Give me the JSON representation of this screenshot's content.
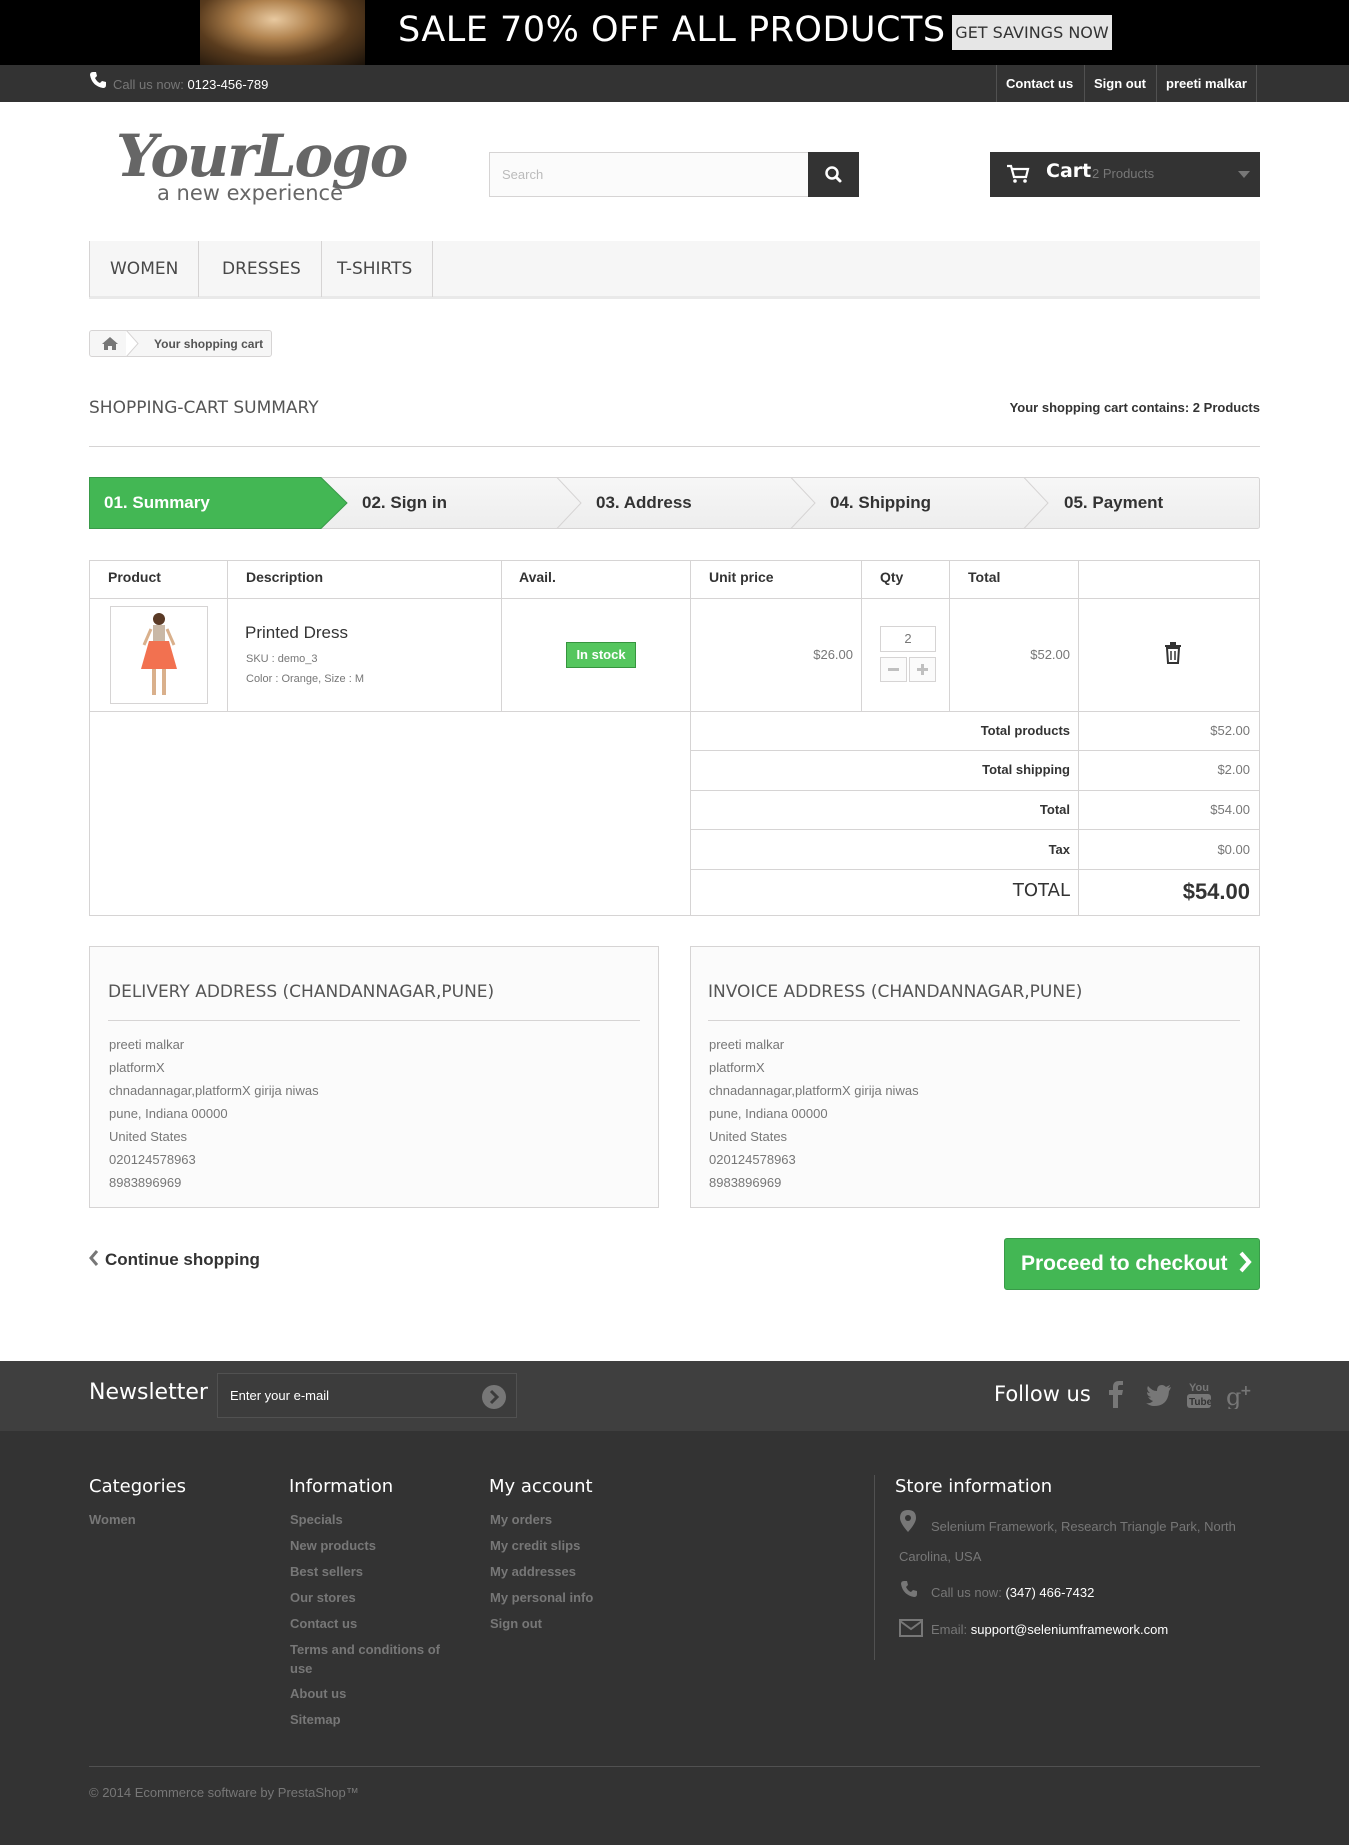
{
  "banner": {
    "text": "SALE 70% OFF ALL PRODUCTS",
    "button": "GET SAVINGS NOW"
  },
  "topbar": {
    "call_label": "Call us now:",
    "phone": "0123-456-789",
    "links": [
      "Contact us",
      "Sign out",
      "preeti malkar"
    ]
  },
  "header": {
    "logo_main": "YourLogo",
    "logo_sub": "a new experience",
    "search_placeholder": "Search",
    "cart_label": "Cart",
    "cart_count": "2 Products"
  },
  "menu": [
    "WOMEN",
    "DRESSES",
    "T-SHIRTS"
  ],
  "breadcrumb": {
    "current": "Your shopping cart"
  },
  "page": {
    "title": "SHOPPING-CART SUMMARY",
    "contains": "Your shopping cart contains: 2 Products"
  },
  "steps": [
    "01. Summary",
    "02. Sign in",
    "03. Address",
    "04. Shipping",
    "05. Payment"
  ],
  "table": {
    "headers": [
      "Product",
      "Description",
      "Avail.",
      "Unit price",
      "Qty",
      "Total"
    ],
    "item": {
      "name": "Printed Dress",
      "sku": "SKU : demo_3",
      "attrs": "Color : Orange, Size : M",
      "avail": "In stock",
      "unit_price": "$26.00",
      "qty": "2",
      "total": "$52.00"
    },
    "totals": [
      {
        "label": "Total products",
        "value": "$52.00"
      },
      {
        "label": "Total shipping",
        "value": "$2.00"
      },
      {
        "label": "Total",
        "value": "$54.00"
      },
      {
        "label": "Tax",
        "value": "$0.00"
      }
    ],
    "grand_label": "TOTAL",
    "grand_value": "$54.00"
  },
  "delivery": {
    "title": "DELIVERY ADDRESS (CHANDANNAGAR,PUNE)",
    "lines": [
      "preeti malkar",
      "platformX",
      "chnadannagar,platformX girija niwas",
      "pune, Indiana 00000",
      "United States",
      "020124578963",
      "8983896969"
    ]
  },
  "invoice": {
    "title": "INVOICE ADDRESS (CHANDANNAGAR,PUNE)",
    "lines": [
      "preeti malkar",
      "platformX",
      "chnadannagar,platformX girija niwas",
      "pune, Indiana 00000",
      "United States",
      "020124578963",
      "8983896969"
    ]
  },
  "actions": {
    "continue": "Continue shopping",
    "proceed": "Proceed to checkout"
  },
  "footer": {
    "newsletter_title": "Newsletter",
    "newsletter_placeholder": "Enter your e-mail",
    "follow": "Follow us",
    "categories": {
      "title": "Categories",
      "links": [
        "Women"
      ]
    },
    "information": {
      "title": "Information",
      "links": [
        "Specials",
        "New products",
        "Best sellers",
        "Our stores",
        "Contact us",
        "Terms and conditions of",
        "use",
        "About us",
        "Sitemap"
      ]
    },
    "account": {
      "title": "My account",
      "links": [
        "My orders",
        "My credit slips",
        "My addresses",
        "My personal info",
        "Sign out"
      ]
    },
    "store": {
      "title": "Store information",
      "address1": "Selenium Framework, Research Triangle Park, North",
      "address2": "Carolina, USA",
      "call_label": "Call us now:",
      "phone": "(347) 466-7432",
      "email_label": "Email:",
      "email": "support@seleniumframework.com"
    },
    "copyright": "© 2014 Ecommerce software by PrestaShop™"
  },
  "colors": {
    "accent_green": "#43b754",
    "dark": "#333333"
  }
}
